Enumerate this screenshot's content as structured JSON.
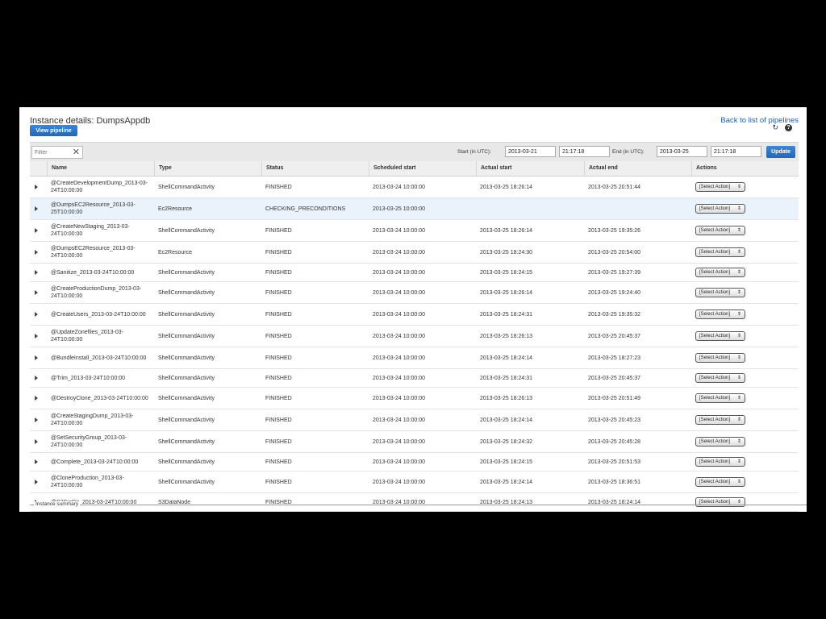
{
  "header": {
    "title": "Instance details: DumpsAppdb",
    "back_link": "Back to list of pipelines",
    "view_pipeline_label": "View pipeline",
    "refresh_glyph": "↻",
    "help_glyph": "?"
  },
  "toolbar": {
    "filter_placeholder": "Filter",
    "clear_glyph": "✕",
    "start_label": "Start (in UTC):",
    "start_date": "2013-03-21",
    "start_time": "21:17:18",
    "end_label": "End (in UTC):",
    "end_date": "2013-03-25",
    "end_time": "21:17:18",
    "update_label": "Update"
  },
  "table": {
    "columns": [
      "Name",
      "Type",
      "Status",
      "Scheduled start",
      "Actual start",
      "Actual end",
      "Actions"
    ],
    "action_label": "[Select Action]",
    "action_glyph": "⇕",
    "rows": [
      {
        "name": "@CreateDevelopmentDump_2013-03-24T10:00:00",
        "type": "ShellCommandActivity",
        "status": "FINISHED",
        "scheduled": "2013-03-24 10:00:00",
        "start": "2013-03-25 18:26:14",
        "end": "2013-03-25 20:51:44"
      },
      {
        "name": "@DumpsEC2Resource_2013-03-25T10:00:00",
        "type": "Ec2Resource",
        "status": "CHECKING_PRECONDITIONS",
        "scheduled": "2013-03-25 10:00:00",
        "start": "",
        "end": ""
      },
      {
        "name": "@CreateNewStaging_2013-03-24T10:00:00",
        "type": "ShellCommandActivity",
        "status": "FINISHED",
        "scheduled": "2013-03-24 10:00:00",
        "start": "2013-03-25 18:26:14",
        "end": "2013-03-25 19:35:26"
      },
      {
        "name": "@DumpsEC2Resource_2013-03-24T10:00:00",
        "type": "Ec2Resource",
        "status": "FINISHED",
        "scheduled": "2013-03-24 10:00:00",
        "start": "2013-03-25 18:24:30",
        "end": "2013-03-25 20:54:00"
      },
      {
        "name": "@Sanitize_2013-03-24T10:00:00",
        "type": "ShellCommandActivity",
        "status": "FINISHED",
        "scheduled": "2013-03-24 10:00:00",
        "start": "2013-03-25 18:24:15",
        "end": "2013-03-25 19:27:39"
      },
      {
        "name": "@CreateProductionDump_2013-03-24T10:00:00",
        "type": "ShellCommandActivity",
        "status": "FINISHED",
        "scheduled": "2013-03-24 10:00:00",
        "start": "2013-03-25 18:26:14",
        "end": "2013-03-25 19:24:40"
      },
      {
        "name": "@CreateUsers_2013-03-24T10:00:00",
        "type": "ShellCommandActivity",
        "status": "FINISHED",
        "scheduled": "2013-03-24 10:00:00",
        "start": "2013-03-25 18:24:31",
        "end": "2013-03-25 19:35:32"
      },
      {
        "name": "@UpdateZonefiles_2013-03-24T10:00:00",
        "type": "ShellCommandActivity",
        "status": "FINISHED",
        "scheduled": "2013-03-24 10:00:00",
        "start": "2013-03-25 18:26:13",
        "end": "2013-03-25 20:45:37"
      },
      {
        "name": "@BundleInstall_2013-03-24T10:00:00",
        "type": "ShellCommandActivity",
        "status": "FINISHED",
        "scheduled": "2013-03-24 10:00:00",
        "start": "2013-03-25 18:24:14",
        "end": "2013-03-25 18:27:23"
      },
      {
        "name": "@Trim_2013-03-24T10:00:00",
        "type": "ShellCommandActivity",
        "status": "FINISHED",
        "scheduled": "2013-03-24 10:00:00",
        "start": "2013-03-25 18:24:31",
        "end": "2013-03-25 20:45:37"
      },
      {
        "name": "@DestroyClone_2013-03-24T10:00:00",
        "type": "ShellCommandActivity",
        "status": "FINISHED",
        "scheduled": "2013-03-24 10:00:00",
        "start": "2013-03-25 18:26:13",
        "end": "2013-03-25 20:51:49"
      },
      {
        "name": "@CreateStagingDump_2013-03-24T10:00:00",
        "type": "ShellCommandActivity",
        "status": "FINISHED",
        "scheduled": "2013-03-24 10:00:00",
        "start": "2013-03-25 18:24:14",
        "end": "2013-03-25 20:45:23"
      },
      {
        "name": "@SetSecurityGroup_2013-03-24T10:00:00",
        "type": "ShellCommandActivity",
        "status": "FINISHED",
        "scheduled": "2013-03-24 10:00:00",
        "start": "2013-03-25 18:24:32",
        "end": "2013-03-25 20:45:28"
      },
      {
        "name": "@Complete_2013-03-24T10:00:00",
        "type": "ShellCommandActivity",
        "status": "FINISHED",
        "scheduled": "2013-03-24 10:00:00",
        "start": "2013-03-25 18:24:15",
        "end": "2013-03-25 20:51:53"
      },
      {
        "name": "@CloneProduction_2013-03-24T10:00:00",
        "type": "ShellCommandActivity",
        "status": "FINISHED",
        "scheduled": "2013-03-24 10:00:00",
        "start": "2013-03-25 18:24:14",
        "end": "2013-03-25 18:36:51"
      },
      {
        "name": "@S3SrcDir_2013-03-24T10:00:00",
        "type": "S3DataNode",
        "status": "FINISHED",
        "scheduled": "2013-03-24 10:00:00",
        "start": "2013-03-25 18:24:13",
        "end": "2013-03-25 18:24:14"
      }
    ]
  },
  "summary": {
    "legend": "Instance summary"
  }
}
